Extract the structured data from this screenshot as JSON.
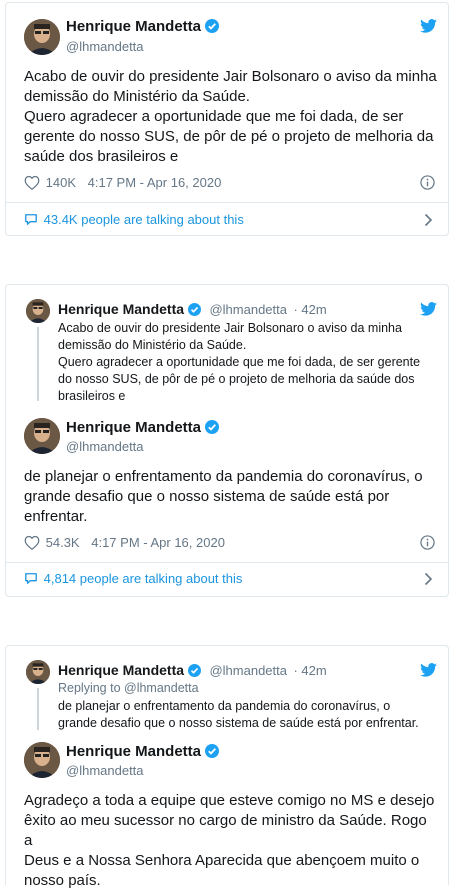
{
  "colors": {
    "accent": "#1da1f2",
    "link": "#1b95e0",
    "muted": "#657786",
    "border": "#e1e8ed"
  },
  "icons": {
    "verified": "verified-badge-icon",
    "twitter": "twitter-bird-icon",
    "like": "heart-icon",
    "info": "info-icon",
    "chevron": "chevron-right-icon"
  },
  "tweets": [
    {
      "author": {
        "name": "Henrique Mandetta",
        "handle": "@lhmandetta"
      },
      "lines": [
        "Acabo de ouvir do presidente Jair Bolsonaro o aviso da minha",
        "demissão do Ministério da Saúde.",
        "Quero agradecer a oportunidade que me foi dada, de ser",
        "gerente do nosso SUS, de pôr de pé o projeto de melhoria da",
        "saúde dos brasileiros e"
      ],
      "likes": "140K",
      "timestamp": "4:17 PM - Apr 16, 2020",
      "talking": "43.4K people are talking about this"
    },
    {
      "parent": {
        "name": "Henrique Mandetta",
        "handle": "@lhmandetta",
        "age": "· 42m",
        "lines": [
          "Acabo de ouvir do presidente Jair Bolsonaro o aviso da minha",
          "demissão do Ministério da Saúde.",
          "Quero agradecer a oportunidade que me foi dada, de ser gerente",
          "do nosso SUS, de pôr de pé o projeto de melhoria da saúde dos",
          "brasileiros e"
        ]
      },
      "author": {
        "name": "Henrique Mandetta",
        "handle": "@lhmandetta"
      },
      "lines": [
        "de planejar o enfrentamento da pandemia do coronavírus, o",
        "grande desafio que o nosso sistema de saúde está por",
        "enfrentar."
      ],
      "likes": "54.3K",
      "timestamp": "4:17 PM - Apr 16, 2020",
      "talking": "4,814 people are talking about this"
    },
    {
      "parent": {
        "name": "Henrique Mandetta",
        "handle": "@lhmandetta",
        "age": "· 42m",
        "replying": "Replying to @lhmandetta",
        "lines": [
          "de planejar o enfrentamento da pandemia do coronavírus, o",
          "grande desafio que o nosso sistema de saúde está por enfrentar."
        ]
      },
      "author": {
        "name": "Henrique Mandetta",
        "handle": "@lhmandetta"
      },
      "lines": [
        "Agradeço a toda a equipe que esteve comigo no MS e desejo",
        "êxito ao meu sucessor no cargo de ministro da Saúde. Rogo a",
        "Deus e a Nossa Senhora Aparecida que abençoem muito o",
        "nosso país."
      ]
    }
  ]
}
